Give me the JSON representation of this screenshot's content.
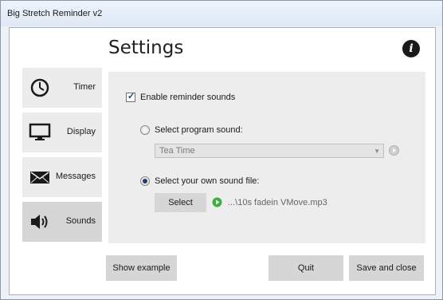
{
  "window": {
    "title": "Big Stretch Reminder v2"
  },
  "header": {
    "title": "Settings",
    "info_icon": "info-icon"
  },
  "sidebar": {
    "items": [
      {
        "label": "Timer",
        "icon": "clock-icon",
        "active": false
      },
      {
        "label": "Display",
        "icon": "monitor-icon",
        "active": false
      },
      {
        "label": "Messages",
        "icon": "envelope-icon",
        "active": false
      },
      {
        "label": "Sounds",
        "icon": "speaker-icon",
        "active": true
      }
    ]
  },
  "sounds": {
    "enable_label": "Enable reminder sounds",
    "enable_checked": true,
    "program_sound_label": "Select program sound:",
    "program_sound_selected": false,
    "program_sound_value": "Tea Time",
    "own_file_label": "Select your own sound file:",
    "own_file_selected": true,
    "select_button": "Select",
    "file_name": "...\\10s fadein VMove.mp3"
  },
  "footer": {
    "show_example": "Show example",
    "quit": "Quit",
    "save_close": "Save and close"
  },
  "colors": {
    "accent_green": "#3fae3f",
    "active_nav": "#d5d5d5",
    "radio_dot": "#273a6e"
  }
}
